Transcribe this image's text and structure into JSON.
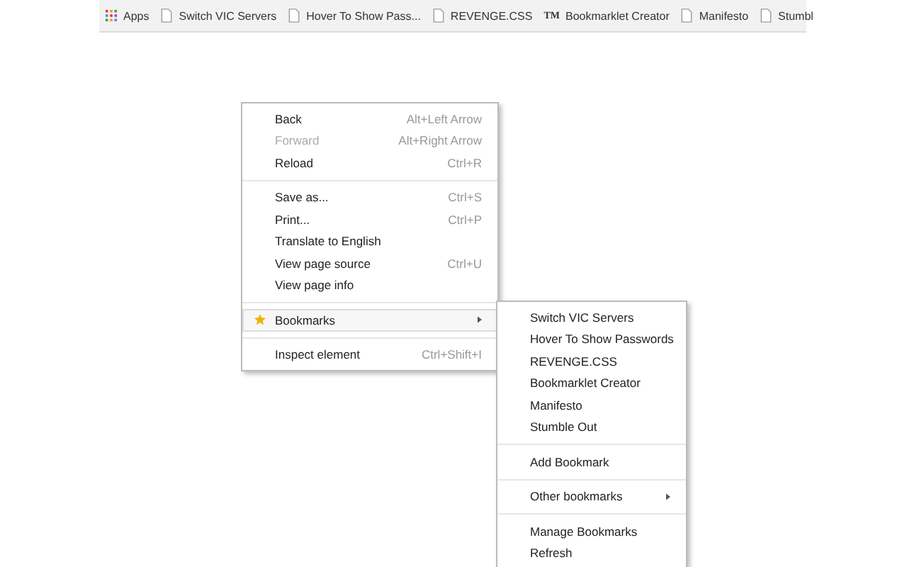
{
  "bookmarks_bar": [
    {
      "kind": "apps",
      "label": "Apps"
    },
    {
      "kind": "page",
      "label": "Switch VIC Servers"
    },
    {
      "kind": "page",
      "label": "Hover To Show Pass..."
    },
    {
      "kind": "page",
      "label": "REVENGE.CSS"
    },
    {
      "kind": "text-icon",
      "icon_text": "TM",
      "label": "Bookmarklet Creator"
    },
    {
      "kind": "page",
      "label": "Manifesto"
    },
    {
      "kind": "page",
      "label": "Stumbl"
    }
  ],
  "context_menu": {
    "items": [
      {
        "kind": "item",
        "label": "Back",
        "shortcut": "Alt+Left Arrow",
        "disabled": false
      },
      {
        "kind": "item",
        "label": "Forward",
        "shortcut": "Alt+Right Arrow",
        "disabled": true
      },
      {
        "kind": "item",
        "label": "Reload",
        "shortcut": "Ctrl+R",
        "disabled": false
      },
      {
        "kind": "separator"
      },
      {
        "kind": "item",
        "label": "Save as...",
        "shortcut": "Ctrl+S",
        "disabled": false
      },
      {
        "kind": "item",
        "label": "Print...",
        "shortcut": "Ctrl+P",
        "disabled": false
      },
      {
        "kind": "item",
        "label": "Translate to English",
        "disabled": false
      },
      {
        "kind": "item",
        "label": "View page source",
        "shortcut": "Ctrl+U",
        "disabled": false
      },
      {
        "kind": "item",
        "label": "View page info",
        "disabled": false
      },
      {
        "kind": "separator"
      },
      {
        "kind": "submenu",
        "label": "Bookmarks",
        "star": true,
        "selected": true
      },
      {
        "kind": "separator"
      },
      {
        "kind": "item",
        "label": "Inspect element",
        "shortcut": "Ctrl+Shift+I",
        "disabled": false
      }
    ]
  },
  "bookmarks_submenu": {
    "items": [
      {
        "kind": "item",
        "label": "Switch VIC Servers"
      },
      {
        "kind": "item",
        "label": "Hover To Show Passwords"
      },
      {
        "kind": "item",
        "label": "REVENGE.CSS"
      },
      {
        "kind": "item",
        "label": "Bookmarklet Creator"
      },
      {
        "kind": "item",
        "label": "Manifesto"
      },
      {
        "kind": "item",
        "label": "Stumble Out"
      },
      {
        "kind": "separator"
      },
      {
        "kind": "item",
        "label": "Add Bookmark"
      },
      {
        "kind": "separator"
      },
      {
        "kind": "submenu",
        "label": "Other bookmarks",
        "selected": false
      },
      {
        "kind": "separator"
      },
      {
        "kind": "item",
        "label": "Manage Bookmarks"
      },
      {
        "kind": "item",
        "label": "Refresh"
      }
    ]
  }
}
